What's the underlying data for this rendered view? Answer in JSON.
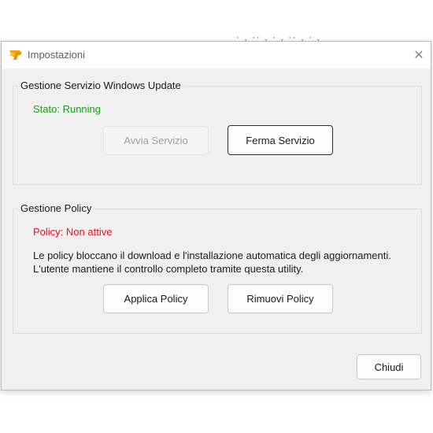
{
  "window": {
    "title": "Impostazioni",
    "close_glyph": "✕",
    "icon": "app-logo-icon",
    "accent_color": "#f5a300"
  },
  "service_group": {
    "label": "Gestione Servizio Windows Update",
    "status_text": "Stato: Running",
    "status_color": "#1e9b1e",
    "start_button": "Avvia Servizio",
    "stop_button": "Ferma Servizio"
  },
  "policy_group": {
    "label": "Gestione Policy",
    "status_text": "Policy: Non attive",
    "status_color": "#e81123",
    "description_line1": "Le policy bloccano il download e l'installazione automatica degli aggiornamenti.",
    "description_line2": "L'utente mantiene il controllo completo tramite questa utility.",
    "apply_button": "Applica Policy",
    "remove_button": "Rimuovi Policy"
  },
  "footer": {
    "close_button": "Chiudi"
  }
}
